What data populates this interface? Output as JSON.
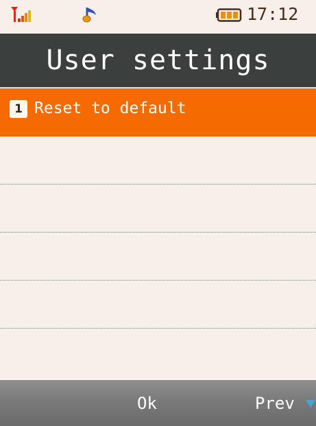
{
  "status_bar": {
    "time": "17:12",
    "icons": [
      "signal-strength-icon",
      "music-note-icon",
      "battery-icon"
    ]
  },
  "header": {
    "title": "User settings"
  },
  "menu": {
    "items": [
      {
        "number": "1",
        "label": "Reset to default",
        "selected": true
      }
    ]
  },
  "softkeys": {
    "center": "Ok",
    "right": "Prev"
  },
  "colors": {
    "background": "#f7efe9",
    "title_bar": "#3b403f",
    "selection": "#f56b00",
    "softkey_bar": "#7a7a7a",
    "accent_arrow": "#38a9e0"
  }
}
